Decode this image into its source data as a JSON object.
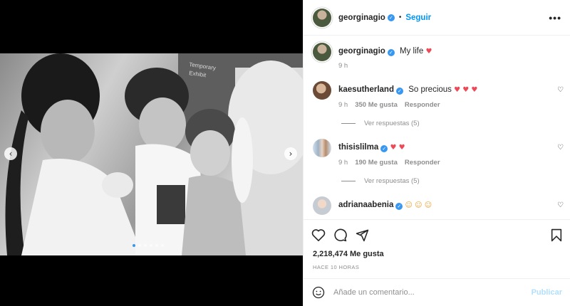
{
  "post": {
    "username": "georginagio",
    "follow_label": "Seguir",
    "separator": "•",
    "more_label": "•••"
  },
  "caption": {
    "username": "georginagio",
    "text": "My life",
    "hearts": "♥",
    "time": "9 h"
  },
  "comments": [
    {
      "username": "kaesutherland",
      "text": "So precious",
      "hearts": "♥ ♥ ♥",
      "time": "9 h",
      "likes": "350 Me gusta",
      "reply": "Responder",
      "replies": "Ver respuestas (5)"
    },
    {
      "username": "thisislilma",
      "text": "",
      "hearts": "♥ ♥",
      "time": "9 h",
      "likes": "190 Me gusta",
      "reply": "Responder",
      "replies": "Ver respuestas (5)"
    },
    {
      "username": "adrianaabenia",
      "text": "",
      "emojis": "☺ ☺ ☺"
    }
  ],
  "actions": {
    "likes": "2,218,474 Me gusta",
    "time_ago": "HACE 10 HORAS"
  },
  "add_comment": {
    "placeholder": "Añade un comentario...",
    "publish": "Publicar"
  },
  "photo": {
    "sign_text": "Temporary Exhibit",
    "carousel_count": 6,
    "carousel_active": 1
  },
  "colors": {
    "link": "#0095f6",
    "verified": "#3897f0",
    "heart": "#ed4956",
    "muted": "#8e8e8e",
    "publish_disabled": "#b2dffc"
  },
  "icons": [
    "heart-icon",
    "comment-icon",
    "share-icon",
    "bookmark-icon",
    "emoji-icon",
    "verified-icon",
    "chevron-left-icon",
    "chevron-right-icon"
  ]
}
